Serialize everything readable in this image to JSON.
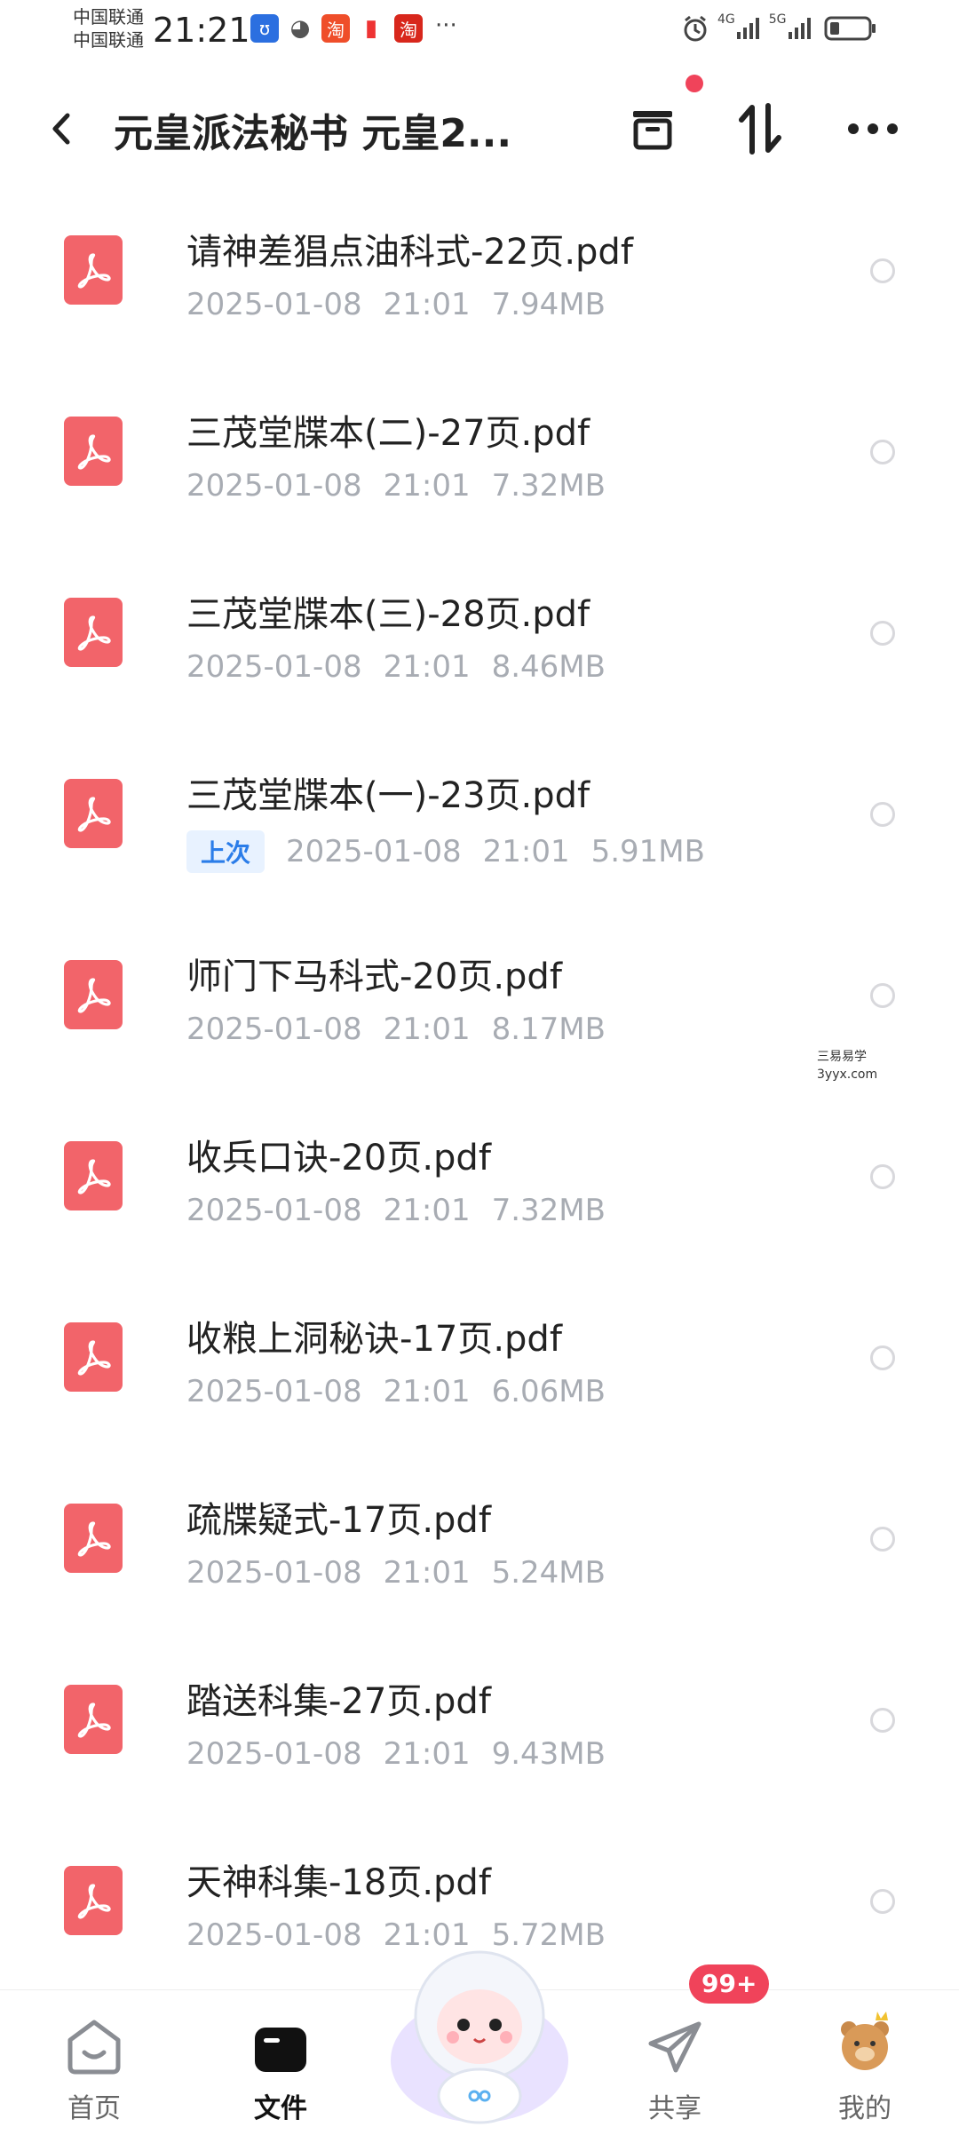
{
  "status_bar": {
    "carrier_1": "中国联通",
    "carrier_2": "中国联通",
    "time": "21:21",
    "more": "···",
    "net_1": "4G",
    "net_2": "5G"
  },
  "header": {
    "title": "元皇派法秘书 元皇2...",
    "icons": [
      "back-icon",
      "archive-icon",
      "sort-icon",
      "more-icon"
    ]
  },
  "files": [
    {
      "name": "请神差猖点油科式-22页.pdf",
      "date": "2025-01-08",
      "time": "21:01",
      "size": "7.94MB",
      "last": ""
    },
    {
      "name": "三茂堂牒本(二)-27页.pdf",
      "date": "2025-01-08",
      "time": "21:01",
      "size": "7.32MB",
      "last": ""
    },
    {
      "name": "三茂堂牒本(三)-28页.pdf",
      "date": "2025-01-08",
      "time": "21:01",
      "size": "8.46MB",
      "last": ""
    },
    {
      "name": "三茂堂牒本(一)-23页.pdf",
      "date": "2025-01-08",
      "time": "21:01",
      "size": "5.91MB",
      "last": "上次"
    },
    {
      "name": "师门下马科式-20页.pdf",
      "date": "2025-01-08",
      "time": "21:01",
      "size": "8.17MB",
      "last": ""
    },
    {
      "name": "收兵口诀-20页.pdf",
      "date": "2025-01-08",
      "time": "21:01",
      "size": "7.32MB",
      "last": ""
    },
    {
      "name": "收粮上洞秘诀-17页.pdf",
      "date": "2025-01-08",
      "time": "21:01",
      "size": "6.06MB",
      "last": ""
    },
    {
      "name": "疏牒疑式-17页.pdf",
      "date": "2025-01-08",
      "time": "21:01",
      "size": "5.24MB",
      "last": ""
    },
    {
      "name": "踏送科集-27页.pdf",
      "date": "2025-01-08",
      "time": "21:01",
      "size": "9.43MB",
      "last": ""
    },
    {
      "name": "天神科集-18页.pdf",
      "date": "2025-01-08",
      "time": "21:01",
      "size": "5.72MB",
      "last": ""
    }
  ],
  "watermark": {
    "line1": "三易易学",
    "line2": "3yyx.com"
  },
  "bottom_nav": {
    "home": "首页",
    "files": "文件",
    "share": "共享",
    "mine": "我的",
    "share_badge": "99+",
    "active": "files"
  },
  "colors": {
    "pdf": "#f2646a",
    "accent": "#f0435a",
    "last_badge_bg": "#e8f2ff",
    "last_badge_fg": "#2b7de9"
  }
}
